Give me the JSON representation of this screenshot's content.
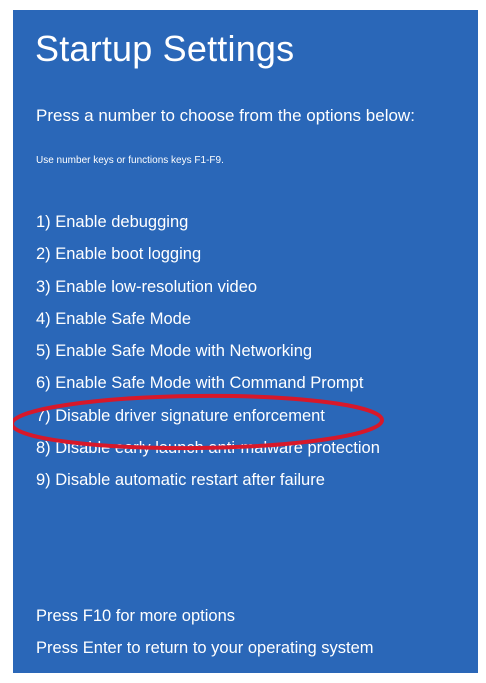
{
  "screen": {
    "title": "Startup Settings",
    "subtitle": "Press a number to choose from the options below:",
    "hint": "Use number keys or functions keys F1-F9.",
    "options": [
      "1) Enable debugging",
      "2) Enable boot logging",
      "3) Enable low-resolution video",
      "4) Enable Safe Mode",
      "5) Enable Safe Mode with Networking",
      "6) Enable Safe Mode with Command Prompt",
      "7) Disable driver signature enforcement",
      "8) Disable early launch anti-malware protection",
      "9) Disable automatic restart after failure"
    ],
    "footer": {
      "more_options": "Press F10 for more options",
      "return": "Press Enter to return to your operating system"
    }
  },
  "colors": {
    "background": "#2a67b8",
    "text": "#ffffff",
    "highlight": "#d7182a"
  }
}
